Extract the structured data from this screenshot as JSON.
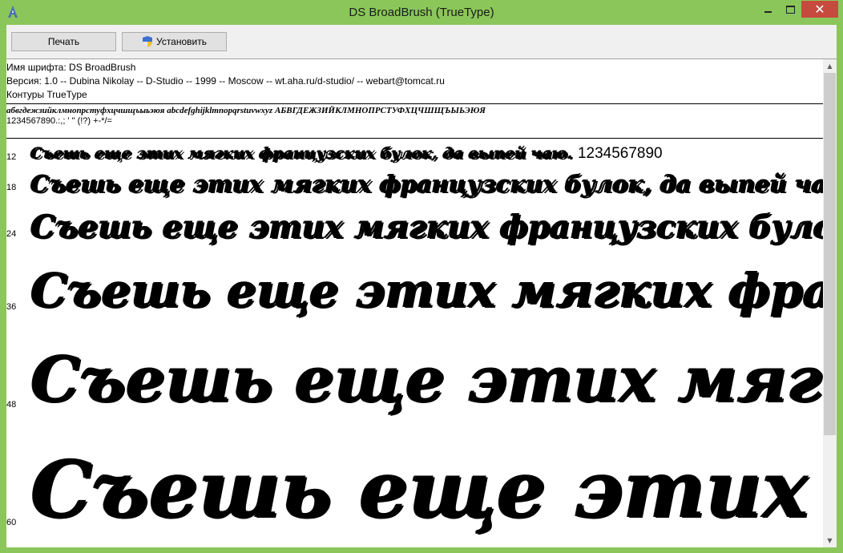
{
  "window": {
    "title": "DS BroadBrush (TrueType)",
    "minimize": "minimize",
    "maximize": "maximize",
    "close": "✕"
  },
  "toolbar": {
    "print_label": "Печать",
    "install_label": "Установить"
  },
  "info": {
    "name_line": "Имя шрифта: DS BroadBrush",
    "version_line": "Версия: 1.0 -- Dubina Nikolay -- D-Studio -- 1999 -- Moscow -- wt.aha.ru/d-studio/ -- webart@tomcat.ru",
    "outline_line": "Контуры TrueType"
  },
  "charset": {
    "letters": "абвгдежзийклмнопрстуфхцчшщъыьэюя abcdefghijklmnopqrstuvwxyz АБВГДЕЖЗИЙКЛМНОПРСТУФХЦЧШЩЪЫЬЭЮЯ",
    "digits": "1234567890.:,; ' \" (!?) +-*/="
  },
  "samples": [
    {
      "size": "12",
      "text": "Съешь еще этих мягких французских булок, да выпей чаю.",
      "digits": "1234567890"
    },
    {
      "size": "18",
      "text": "Съешь еще этих мягких французских булок, да выпей чаю.",
      "digits": ""
    },
    {
      "size": "24",
      "text": "Съешь еще этих мягких французских булок",
      "digits": ""
    },
    {
      "size": "36",
      "text": "Съешь еще этих мягких французских",
      "digits": ""
    },
    {
      "size": "48",
      "text": "Съешь еще этих мягких",
      "digits": ""
    },
    {
      "size": "60",
      "text": "Съешь еще этих",
      "digits": ""
    }
  ],
  "colors": {
    "frame": "#8bc65a",
    "close_button": "#c74a3e"
  }
}
